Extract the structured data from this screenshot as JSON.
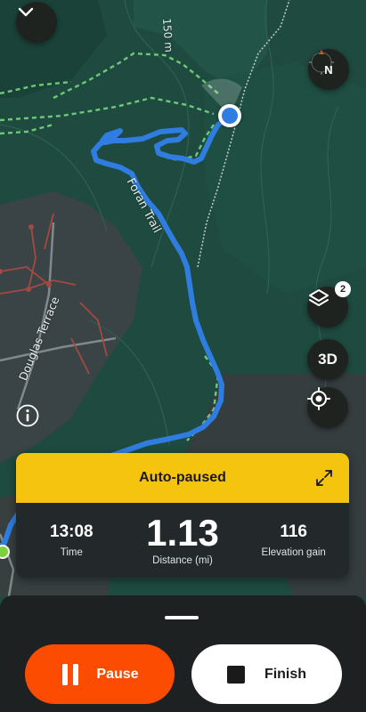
{
  "map": {
    "contour_label": "150 m",
    "trail_label": "Foran Trail",
    "street_label": "Douglas Terrace",
    "compass_label": "N",
    "layers_badge": "2",
    "btn_3d_label": "3D"
  },
  "stats": {
    "status": "Auto-paused",
    "time_value": "13:08",
    "time_label": "Time",
    "distance_value": "1.13",
    "distance_label": "Distance (mi)",
    "elevation_value": "116",
    "elevation_label": "Elevation gain"
  },
  "actions": {
    "pause_label": "Pause",
    "finish_label": "Finish"
  },
  "colors": {
    "accent": "#fc4c02",
    "status_banner": "#f5c40e",
    "route": "#2f7de0",
    "map_green": "#1e4a3f"
  }
}
